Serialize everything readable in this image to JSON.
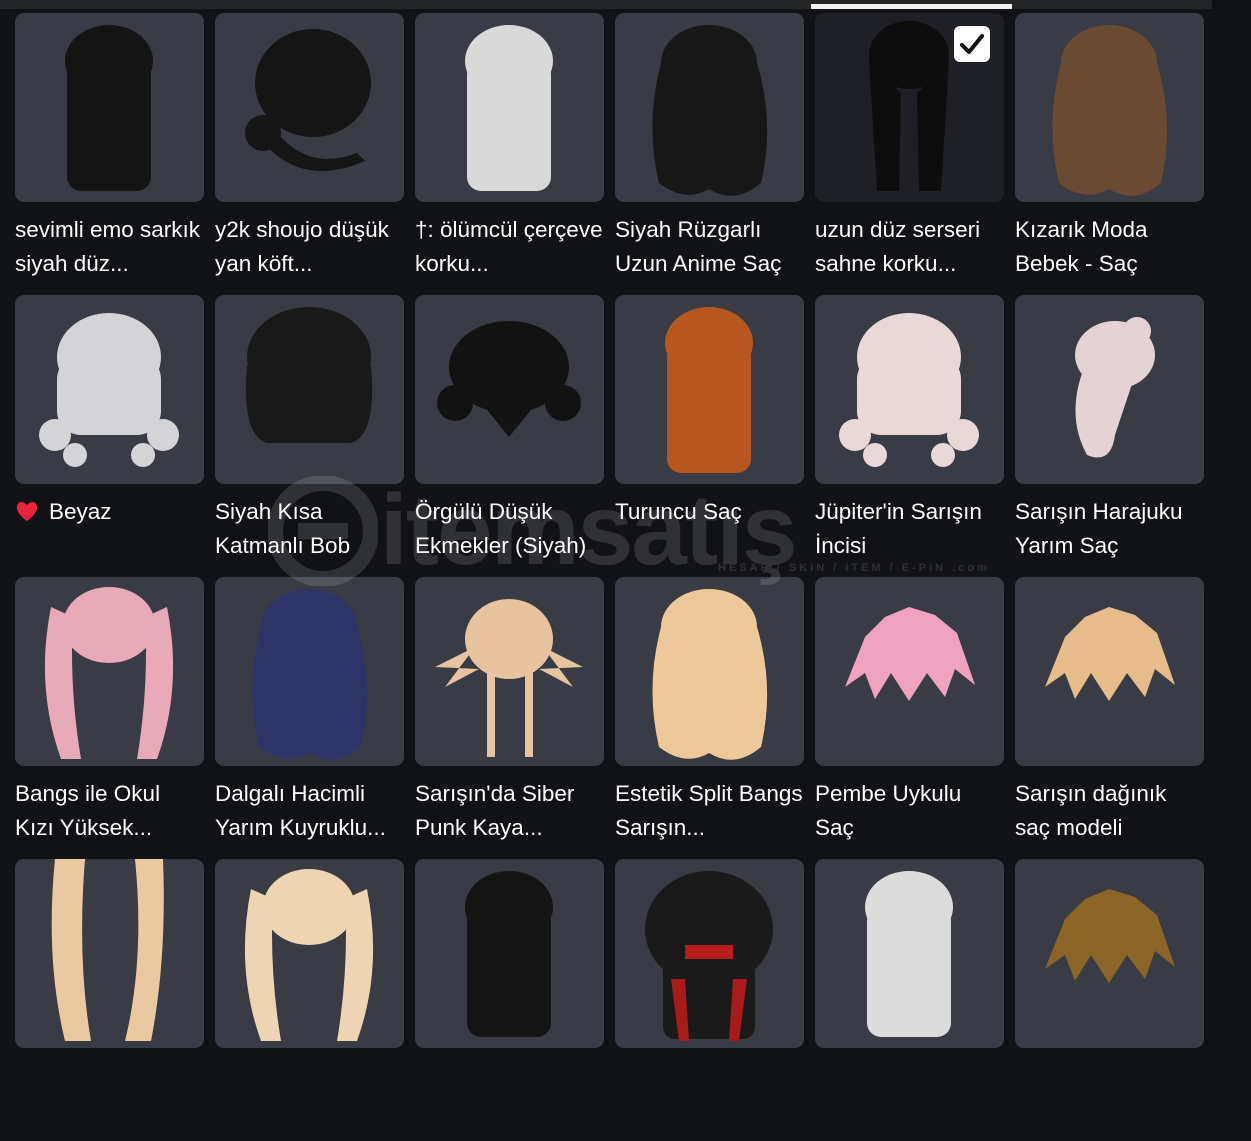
{
  "items": [
    {
      "name": "sevimli emo sarkık siyah düz...",
      "icon": "black-long-straight-hair",
      "c": "#141414",
      "s": "long",
      "selected": false
    },
    {
      "name": "y2k shoujo düşük yan köft...",
      "icon": "black-side-bun-hair",
      "c": "#151515",
      "s": "bun",
      "selected": false
    },
    {
      "name": "†: ölümcül çerçeve korku...",
      "icon": "white-long-hair",
      "c": "#d9d9d9",
      "s": "long",
      "selected": false
    },
    {
      "name": "Siyah Rüzgarlı Uzun Anime Saç",
      "icon": "black-windswept-long-hair",
      "c": "#171717",
      "s": "wavy",
      "selected": false
    },
    {
      "name": "uzun düz serseri sahne korku...",
      "icon": "black-straight-split-hair",
      "c": "#0d0d0d",
      "s": "split",
      "selected": true
    },
    {
      "name": "Kızarık Moda Bebek - Saç",
      "icon": "brown-wavy-hair",
      "c": "#6b4a33",
      "s": "wavy",
      "selected": false
    },
    {
      "name": "Beyaz",
      "icon": "white-curly-hair",
      "c": "#d4d4d6",
      "s": "curly",
      "selected": false,
      "heart": true
    },
    {
      "name": "Siyah Kısa Katmanlı Bob",
      "icon": "black-layered-bob-hair",
      "c": "#191919",
      "s": "bob",
      "selected": false
    },
    {
      "name": "Örgülü Düşük Ekmekler (Siyah)",
      "icon": "black-braided-buns-hair",
      "c": "#121212",
      "s": "short",
      "selected": false
    },
    {
      "name": "Turuncu Saç",
      "icon": "orange-long-hair",
      "c": "#b8561f",
      "s": "long",
      "selected": false
    },
    {
      "name": "Jüpiter'in Sarışın İncisi",
      "icon": "pearl-curly-hair",
      "c": "#e8d8d8",
      "s": "curly",
      "selected": false
    },
    {
      "name": "Sarışın Harajuku Yarım Saç",
      "icon": "pearl-half-up-hair",
      "c": "#e3d3d5",
      "s": "side",
      "selected": false
    },
    {
      "name": "Bangs ile Okul Kızı Yüksek...",
      "icon": "pink-pigtails-hair",
      "c": "#e8a9b8",
      "s": "pigtails",
      "selected": false
    },
    {
      "name": "Dalgalı Hacimli Yarım Kuyruklu...",
      "icon": "navy-wavy-hair",
      "c": "#2e3468",
      "s": "wavy",
      "selected": false
    },
    {
      "name": "Sarışın'da Siber Punk Kaya...",
      "icon": "blonde-spiky-hair",
      "c": "#e7c39f",
      "s": "spiky",
      "selected": false
    },
    {
      "name": "Estetik Split Bangs Sarışın...",
      "icon": "blonde-wavy-hair",
      "c": "#edc899",
      "s": "wavy",
      "selected": false
    },
    {
      "name": "Pembe Uykulu Saç",
      "icon": "pink-messy-short-hair",
      "c": "#f0a3bf",
      "s": "messy",
      "selected": false
    },
    {
      "name": "Sarışın dağınık saç modeli",
      "icon": "blonde-messy-hair",
      "c": "#e6bd8a",
      "s": "messy",
      "selected": false
    },
    {
      "name": "",
      "icon": "blonde-twin-tails-hair",
      "c": "#eac9a0",
      "s": "twin",
      "selected": false
    },
    {
      "name": "",
      "icon": "blonde-bubble-braids-hair",
      "c": "#eed4b2",
      "s": "pigtails",
      "selected": false
    },
    {
      "name": "",
      "icon": "black-space-buns-hair",
      "c": "#141414",
      "s": "long",
      "selected": false
    },
    {
      "name": "",
      "icon": "black-red-hood-hair",
      "c": "#1a1a1a",
      "s": "hood",
      "selected": false
    },
    {
      "name": "",
      "icon": "white-straight-hair",
      "c": "#dcdcdc",
      "s": "long",
      "selected": false
    },
    {
      "name": "",
      "icon": "brown-short-hair",
      "c": "#8a6527",
      "s": "messy",
      "selected": false
    }
  ],
  "watermark": {
    "brand": "itemsatış",
    "sub": "HESAP / SKIN / ITEM / E-PIN",
    "tld": ".com"
  }
}
